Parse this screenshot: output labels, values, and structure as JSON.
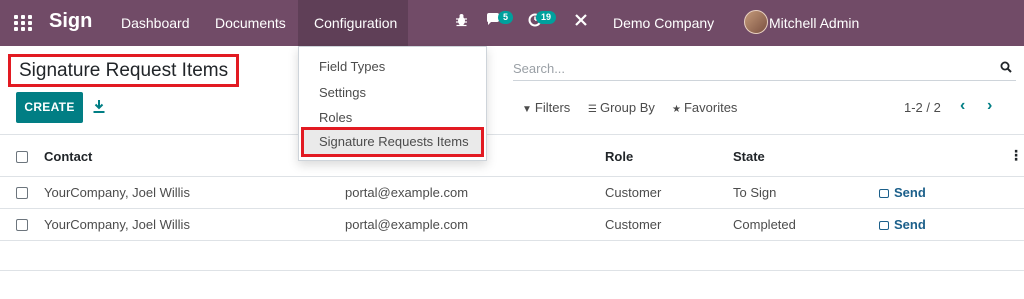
{
  "navbar": {
    "brand": "Sign",
    "menu": {
      "dashboard": "Dashboard",
      "documents": "Documents",
      "configuration": "Configuration"
    },
    "chat_count": "5",
    "activity_count": "19",
    "company": "Demo Company",
    "user": "Mitchell Admin (demo_150_1642031310)"
  },
  "config_menu": {
    "items": [
      "Field Types",
      "Settings",
      "Roles",
      "Signature Requests Items"
    ]
  },
  "page": {
    "title": "Signature Request Items"
  },
  "search": {
    "placeholder": "Search..."
  },
  "toolbar": {
    "create": "CREATE",
    "filters": "Filters",
    "group_by": "Group By",
    "favorites": "Favorites",
    "pager": "1-2 / 2"
  },
  "table": {
    "columns": {
      "contact": "Contact",
      "role": "Role",
      "state": "State"
    },
    "rows": [
      {
        "contact": "YourCompany, Joel Willis",
        "email": "portal@example.com",
        "role": "Customer",
        "state": "To Sign",
        "action": "Send"
      },
      {
        "contact": "YourCompany, Joel Willis",
        "email": "portal@example.com",
        "role": "Customer",
        "state": "Completed",
        "action": "Send"
      }
    ]
  },
  "colors": {
    "navbar": "#714B67",
    "primary": "#017e84",
    "highlight": "#e21a22"
  }
}
